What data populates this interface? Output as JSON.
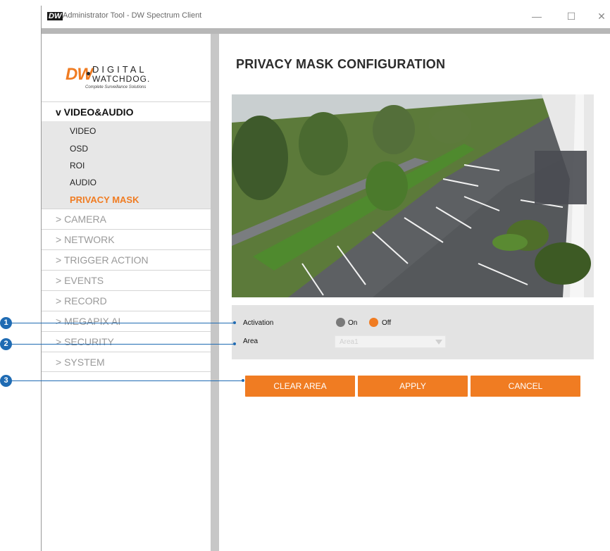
{
  "window": {
    "app_logo": "DW",
    "title": "Administrator Tool - DW Spectrum Client",
    "minimize_glyph": "—",
    "maximize_glyph": "☐",
    "close_glyph": "✕"
  },
  "brand": {
    "dw": "DW",
    "line1": "DIGITAL",
    "line2": "WATCHDOG.",
    "tagline": "Complete Surveillance Solutions"
  },
  "sidebar": {
    "open_section": "v VIDEO&AUDIO",
    "sub_items": [
      "VIDEO",
      "OSD",
      "ROI",
      "AUDIO",
      "PRIVACY MASK"
    ],
    "active_sub_item": "PRIVACY MASK",
    "sections": [
      "> CAMERA",
      "> NETWORK",
      "> TRIGGER ACTION",
      "> EVENTS",
      "> RECORD",
      "> MEGAPIX AI",
      "> SECURITY",
      "> SYSTEM"
    ]
  },
  "main": {
    "page_title": "PRIVACY MASK CONFIGURATION",
    "activation_label": "Activation",
    "activation_options": [
      "On",
      "Off"
    ],
    "activation_selected": "Off",
    "area_label": "Area",
    "area_value": "Area1",
    "buttons": {
      "clear": "CLEAR AREA",
      "apply": "APPLY",
      "cancel": "CANCEL"
    }
  },
  "callouts": [
    "1",
    "2",
    "3"
  ],
  "colors": {
    "accent": "#f07c22",
    "callout": "#1f6bb3",
    "radio_unselected": "#7a7a7a"
  },
  "icons": {
    "minimize": "minimize-icon",
    "maximize": "maximize-icon",
    "close": "close-icon",
    "dropdown": "chevron-down-icon"
  }
}
